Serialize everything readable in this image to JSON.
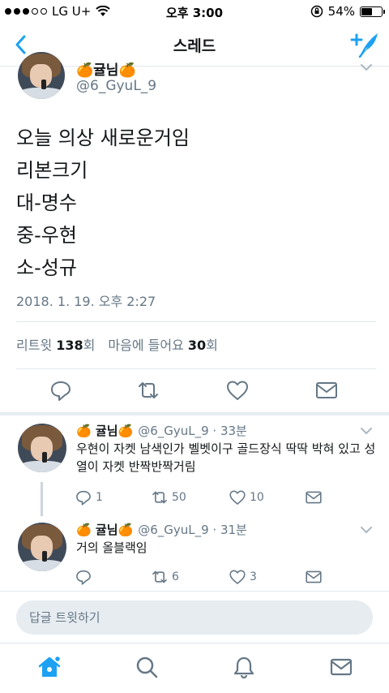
{
  "status_bar": {
    "carrier": "LG U+",
    "time": "오후 3:00",
    "battery_percent": "54%",
    "battery_level": 0.54
  },
  "nav": {
    "title": "스레드",
    "back_icon": "chevron-left-icon",
    "compose_icon": "compose-tweet-icon"
  },
  "main_tweet": {
    "name": "🍊귤님🍊",
    "handle": "@6_GyuL_9",
    "lines": [
      "오늘 의상 새로운거임",
      "리본크기",
      "대-명수",
      "중-우현",
      "소-성규"
    ],
    "date": "2018. 1. 19. 오후 2:27",
    "retweets_label": "리트윗",
    "retweets": "138",
    "retweets_suffix": "회",
    "likes_label": "마음에 들어요",
    "likes": "30",
    "likes_suffix": "회"
  },
  "replies": [
    {
      "name": "🍊 귤님🍊",
      "handle": "@6_GyuL_9 · 33분",
      "text": "우현이 자켓 남색인가 벨벳이구 골드장식 딱딱 박혀 있고 성열이 자켓 반짝반짝거림",
      "replies": "1",
      "retweets": "50",
      "likes": "10"
    },
    {
      "name": "🍊 귤님🍊",
      "handle": "@6_GyuL_9 · 31분",
      "text": "거의 올블랙임",
      "replies": "",
      "retweets": "6",
      "likes": "3"
    }
  ],
  "reply_bar": {
    "placeholder": "답글 트윗하기"
  },
  "colors": {
    "accent": "#1da1f2",
    "secondary_text": "#657786",
    "divider": "#e1e8ed"
  }
}
